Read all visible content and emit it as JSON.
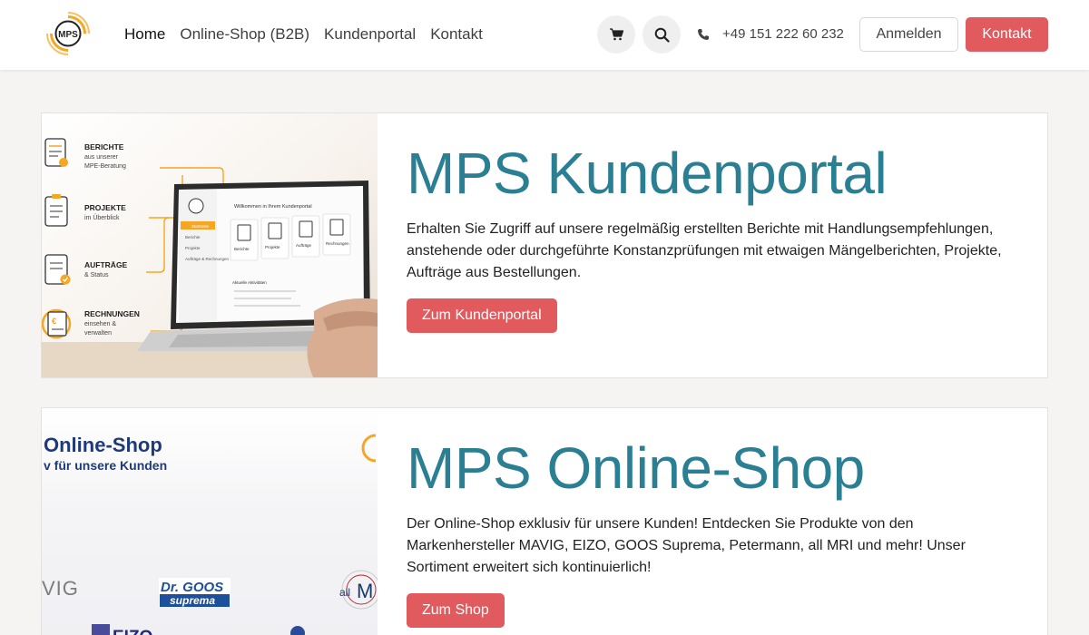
{
  "brand": {
    "logo_text": "MPS"
  },
  "nav": {
    "links": [
      {
        "label": "Home",
        "active": true
      },
      {
        "label": "Online-Shop (B2B)",
        "active": false
      },
      {
        "label": "Kundenportal",
        "active": false
      },
      {
        "label": "Kontakt",
        "active": false
      }
    ],
    "phone": "+49 151 222 60 232",
    "login_label": "Anmelden",
    "contact_label": "Kontakt"
  },
  "colors": {
    "accent": "#e05a5e",
    "title": "#2a7f93",
    "brand_orange": "#f5a623"
  },
  "card_portal": {
    "title": "MPS Kundenportal",
    "text": "Erhalten Sie Zugriff auf unsere regelmäßig erstellten Berichte mit Handlungsempfehlungen, anstehende oder durchgeführte Konstanzprüfungen mit etwaigen Mängelberichten, Projekte, Aufträge aus Bestellungen.",
    "button": "Zum Kundenportal",
    "image": {
      "features": [
        {
          "title": "BERICHTE",
          "sub1": "aus unserer",
          "sub2": "MPE-Beratung"
        },
        {
          "title": "PROJEKTE",
          "sub1": "im Überblick",
          "sub2": ""
        },
        {
          "title": "AUFTRÄGE",
          "sub1": "& Status",
          "sub2": ""
        },
        {
          "title": "RECHNUNGEN",
          "sub1": "einsehen &",
          "sub2": "verwalten"
        }
      ],
      "screen_welcome": "Willkommen in Ihrem Kundenportal",
      "screen_menu": [
        "Startseite",
        "Berichte",
        "Projekte",
        "Aufträge & Rechnungen"
      ],
      "screen_tiles": [
        "Berichte",
        "Projekte",
        "Aufträge",
        "Rechnungen"
      ],
      "screen_section": "Aktuelle Aktivitäten"
    }
  },
  "card_shop": {
    "title": "MPS Online-Shop",
    "text": "Der Online-Shop exklusiv für unsere Kunden! Entdecken Sie Produkte von den Markenhersteller MAVIG, EIZO, GOOS Suprema, Petermann, all MRI und mehr! Unser Sortiment erweitert sich kontinuierlich!",
    "button": "Zum Shop",
    "image": {
      "heading": "Online-Shop",
      "subheading": "v für unsere Kunden",
      "logos": [
        "VIG",
        "Dr. GOOS",
        "suprema",
        "all",
        "EIZO"
      ]
    }
  }
}
